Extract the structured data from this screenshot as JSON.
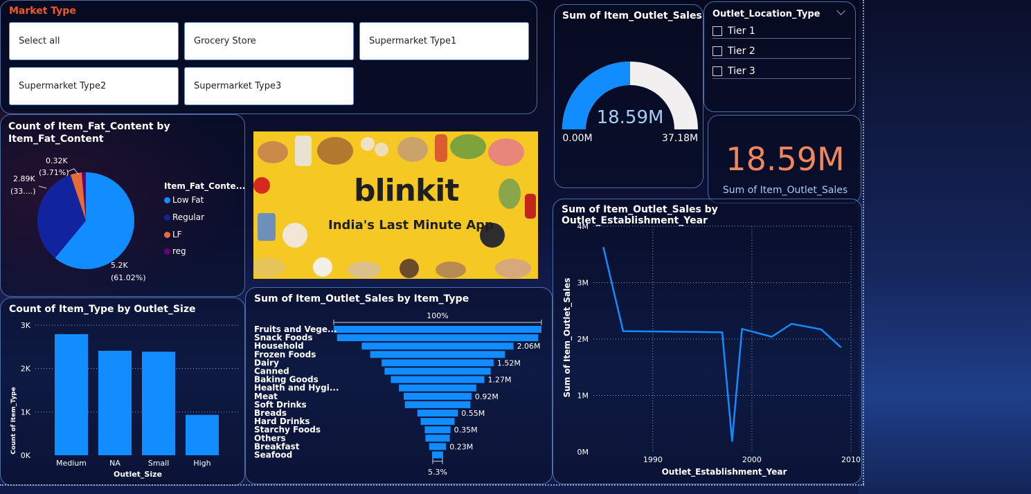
{
  "market_slicer": {
    "title": "Market Type",
    "options": [
      "Select all",
      "Grocery Store",
      "Supermarket Type1",
      "Supermarket Type2",
      "Supermarket Type3"
    ]
  },
  "gauge": {
    "title": "Sum of Item_Outlet_Sales",
    "value_label": "18.59M",
    "min_label": "0.00M",
    "max_label": "37.18M",
    "value": 18.59,
    "min": 0,
    "max": 37.18,
    "fill_color": "#118dff",
    "track_color": "#f1efef"
  },
  "location_slicer": {
    "title": "Outlet_Location_Type",
    "options": [
      "Tier 1",
      "Tier 2",
      "Tier 3"
    ]
  },
  "kpi_card": {
    "value": "18.59M",
    "label": "Sum of Item_Outlet_Sales",
    "value_color": "#f0875c"
  },
  "banner": {
    "brand": "blinkit",
    "tagline": "India's Last Minute App"
  },
  "colors": {
    "accent": "#118dff",
    "dark_blue": "#12239e",
    "orange": "#e66c37",
    "purple": "#6b007b",
    "title_orange": "#f05a28"
  },
  "chart_data": [
    {
      "type": "pie",
      "title": "Count of Item_Fat_Content by Item_Fat_Content",
      "legend_title": "Item_Fat_Conte...",
      "categories": [
        "Low Fat",
        "Regular",
        "LF",
        "reg"
      ],
      "values": [
        5200,
        2890,
        320,
        120
      ],
      "colors": [
        "#118dff",
        "#12239e",
        "#e66c37",
        "#6b007b"
      ],
      "data_labels": [
        {
          "value": "5.2K",
          "pct": "(61.02%)"
        },
        {
          "value": "2.89K",
          "pct": "(33....)"
        },
        {
          "value": "0.32K",
          "pct": "(3.71%)"
        }
      ],
      "legend_position": "right"
    },
    {
      "type": "bar",
      "title": "Count of Item_Type by Outlet_Size",
      "categories": [
        "Medium",
        "NA",
        "Small",
        "High"
      ],
      "values": [
        2793,
        2410,
        2388,
        932
      ],
      "xlabel": "Outlet_Size",
      "ylabel": "Count of Item_Type",
      "ylim": [
        0,
        3000
      ],
      "yticks": [
        "0K",
        "1K",
        "2K",
        "3K"
      ],
      "grid": true
    },
    {
      "type": "bar",
      "orientation": "funnel",
      "title": "Sum of Item_Outlet_Sales by Item_Type",
      "categories": [
        "Fruits and Vege...",
        "Snack Foods",
        "Household",
        "Frozen Foods",
        "Dairy",
        "Canned",
        "Baking Goods",
        "Health and Hygi...",
        "Meat",
        "Soft Drinks",
        "Breads",
        "Hard Drinks",
        "Starchy Foods",
        "Others",
        "Breakfast",
        "Seafood"
      ],
      "values": [
        2.82,
        2.73,
        2.06,
        1.83,
        1.52,
        1.44,
        1.27,
        1.05,
        0.92,
        0.89,
        0.55,
        0.46,
        0.35,
        0.33,
        0.23,
        0.15
      ],
      "data_labels": [
        "",
        "",
        "2.06M",
        "",
        "1.52M",
        "",
        "1.27M",
        "",
        "0.92M",
        "",
        "0.55M",
        "",
        "0.35M",
        "",
        "0.23M",
        ""
      ],
      "top_label": "100%",
      "bottom_label": "5.3%"
    },
    {
      "type": "line",
      "title": "Sum of Item_Outlet_Sales by Outlet_Establishment_Year",
      "x": [
        1985,
        1987,
        1997,
        1998,
        1999,
        2002,
        2004,
        2007,
        2009
      ],
      "y": [
        3.63,
        2.14,
        2.12,
        0.19,
        2.18,
        2.04,
        2.27,
        2.17,
        1.85
      ],
      "xlabel": "Outlet_Establishment_Year",
      "ylabel": "Sum of Item_Outlet_Sales",
      "xlim": [
        1984,
        2010
      ],
      "ylim": [
        0,
        4
      ],
      "xticks": [
        "1990",
        "2000",
        "2010"
      ],
      "yticks": [
        "0M",
        "1M",
        "2M",
        "3M",
        "4M"
      ],
      "grid": true
    }
  ]
}
